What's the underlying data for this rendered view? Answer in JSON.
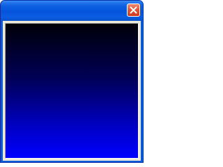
{
  "window": {
    "title": "",
    "close_icon": "close-x-icon",
    "gradient": {
      "top_color": "#000008",
      "bottom_color": "#0000ff"
    }
  }
}
